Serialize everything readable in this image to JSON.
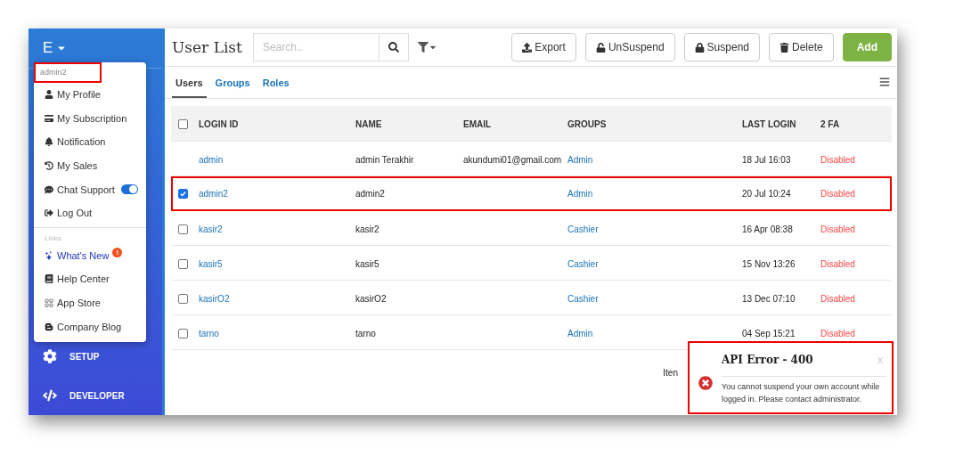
{
  "sidebar": {
    "brand": "E",
    "items": [
      {
        "label": "SETUP"
      },
      {
        "label": "DEVELOPER"
      }
    ]
  },
  "user_menu": {
    "username": "admin2",
    "username_highlighted": true,
    "items": [
      {
        "label": "My Profile",
        "kind": "link"
      },
      {
        "label": "My Subscription",
        "kind": "link"
      },
      {
        "label": "Notification",
        "kind": "link"
      },
      {
        "label": "My Sales",
        "kind": "link"
      },
      {
        "label": "Chat Support",
        "kind": "toggle",
        "on": true
      },
      {
        "label": "Log Out",
        "kind": "link"
      }
    ],
    "section_label": "Links",
    "links": [
      {
        "label": "What's New",
        "kind": "featured",
        "badge": "!"
      },
      {
        "label": "Help Center",
        "kind": "link"
      },
      {
        "label": "App Store",
        "kind": "link"
      },
      {
        "label": "Company Blog",
        "kind": "link"
      }
    ]
  },
  "header": {
    "title": "User List",
    "search": {
      "placeholder": "Search.."
    },
    "buttons": [
      {
        "label": "Export",
        "kind": "default"
      },
      {
        "label": "UnSuspend",
        "kind": "default"
      },
      {
        "label": "Suspend",
        "kind": "default"
      },
      {
        "label": "Delete",
        "kind": "default"
      },
      {
        "label": "Add",
        "kind": "primary"
      }
    ]
  },
  "tabs": [
    {
      "label": "Users",
      "selected": true
    },
    {
      "label": "Groups",
      "selected": false
    },
    {
      "label": "Roles",
      "selected": false
    }
  ],
  "table": {
    "all_checked": false,
    "columns": [
      "LOGIN ID",
      "NAME",
      "EMAIL",
      "GROUPS",
      "LAST LOGIN",
      "2 FA"
    ],
    "rows": [
      {
        "kind": "plain",
        "highlighted": false,
        "login_id": "admin",
        "name": "admin Terakhir",
        "email": "akundumi01@gmail.com",
        "group": "Admin",
        "last_login": "18 Jul 16:03",
        "two_fa": "Disabled"
      },
      {
        "kind": "selectable",
        "checked": true,
        "highlighted": true,
        "login_id": "admin2",
        "name": "admin2",
        "group": "Admin",
        "last_login": "20 Jul 10:24",
        "two_fa": "Disabled"
      },
      {
        "kind": "selectable",
        "checked": false,
        "highlighted": false,
        "login_id": "kasir2",
        "name": "kasir2",
        "group": "Cashier",
        "last_login": "16 Apr 08:38",
        "two_fa": "Disabled"
      },
      {
        "kind": "selectable",
        "checked": false,
        "highlighted": false,
        "login_id": "kasir5",
        "name": "kasir5",
        "group": "Cashier",
        "last_login": "15 Nov 13:26",
        "two_fa": "Disabled"
      },
      {
        "kind": "selectable",
        "checked": false,
        "highlighted": false,
        "login_id": "kasirO2",
        "name": "kasirO2",
        "group": "Cashier",
        "last_login": "13 Dec 07:10",
        "two_fa": "Disabled"
      },
      {
        "kind": "selectable",
        "checked": false,
        "highlighted": false,
        "login_id": "tarno",
        "name": "tarno",
        "group": "Admin",
        "last_login": "04 Sep 15:21",
        "two_fa": "Disabled"
      }
    ],
    "footer_text": "Iten"
  },
  "toast": {
    "title": "API Error - 400",
    "message": "You cannot suspend your own account while logged in. Please contact administrator.",
    "close": "x",
    "highlighted": true
  }
}
